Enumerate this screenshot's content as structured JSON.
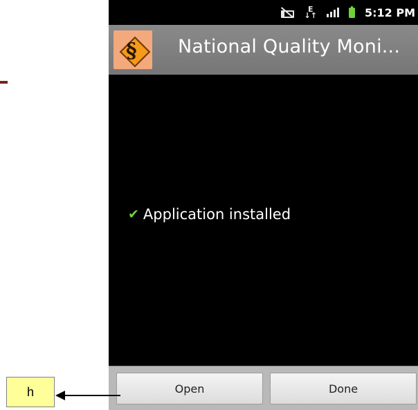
{
  "status_bar": {
    "time": "5:12 PM",
    "icons": [
      "mute-icon",
      "network-edge-icon",
      "signal-icon",
      "battery-icon"
    ],
    "network_label": "E",
    "battery_color": "#6fd23a"
  },
  "title_bar": {
    "title": "National Quality Moni...",
    "app_icon": "app-logo-icon"
  },
  "content": {
    "status_message": "Application installed",
    "status_icon": "check-icon",
    "check_color": "#6fd23a"
  },
  "buttons": {
    "open_label": "Open",
    "done_label": "Done"
  },
  "annotation": {
    "label": "h"
  }
}
